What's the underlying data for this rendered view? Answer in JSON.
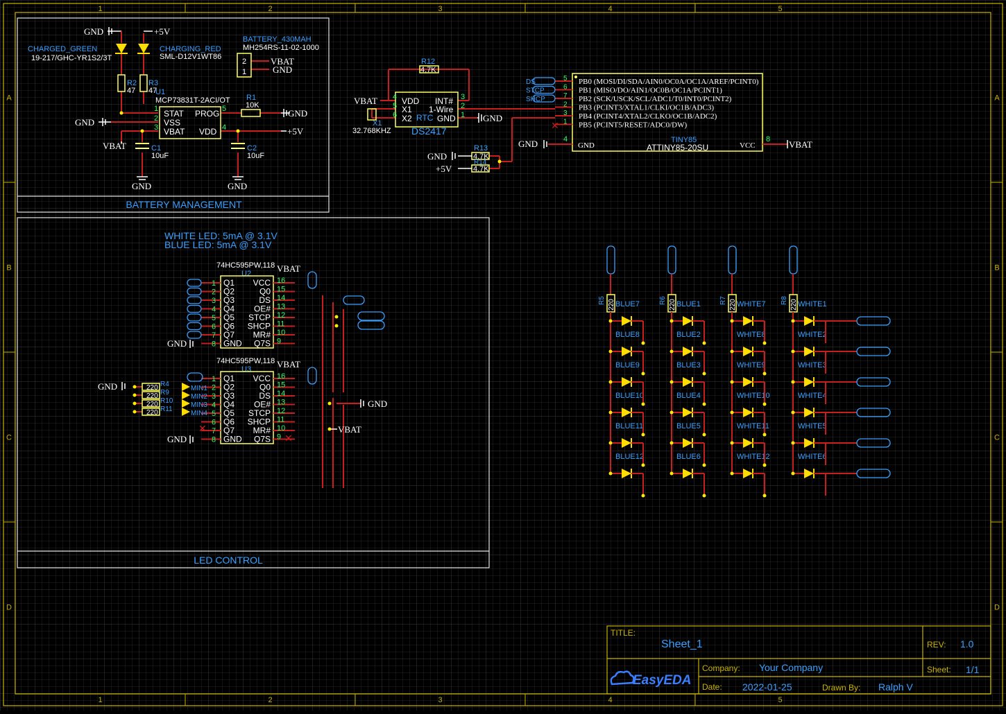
{
  "frame": {
    "columns": [
      "1",
      "2",
      "3",
      "4",
      "5"
    ],
    "rows": [
      "A",
      "B",
      "C",
      "D"
    ]
  },
  "colors": {
    "background": "#000000",
    "grid": "#2a2a2a",
    "frame": "#c8b400",
    "wire": "#c81e1e",
    "body": "#ffff66",
    "pin": "#33ff66",
    "label_blue": "#3aa0ff",
    "net_white": "#ffffff",
    "junction": "#ffee00"
  },
  "battery_management": {
    "title": "BATTERY MANAGEMENT",
    "led_green": {
      "name": "CHARGED_GREEN",
      "part": "19-217/GHC-YR1S2/3T"
    },
    "led_red": {
      "name": "CHARGING_RED",
      "part": "SML-D12V1WT86"
    },
    "battery": {
      "name": "BATTERY_430MAH",
      "part": "MH254RS-11-02-1000",
      "pins": [
        "2",
        "1"
      ]
    },
    "r2": {
      "ref": "R2",
      "value": "47"
    },
    "r3": {
      "ref": "R3",
      "value": "47"
    },
    "u1": {
      "ref": "U1",
      "part": "MCP73831T-2ACI/OT",
      "pins_left": [
        "STAT",
        "VSS",
        "VBAT"
      ],
      "pins_right": [
        "PROG",
        "VDD"
      ],
      "pin_nums_left": [
        "1",
        "2",
        "3"
      ],
      "pin_nums_right": [
        "5",
        "4"
      ]
    },
    "r1": {
      "ref": "R1",
      "value": "10K"
    },
    "c1": {
      "ref": "C1",
      "value": "10uF"
    },
    "c2": {
      "ref": "C2",
      "value": "10uF"
    },
    "nets": {
      "gnd": "GND",
      "vbat": "VBAT",
      "p5v": "+5V"
    }
  },
  "rtc": {
    "ref": "DS2417",
    "pins_left": [
      "VDD",
      "X1",
      "X2"
    ],
    "pins_right": [
      "INT#",
      "1-Wire",
      "GND"
    ],
    "inner": "RTC",
    "pin_nums_left": [
      "4",
      "5",
      "6"
    ],
    "pin_nums_right": [
      "3",
      "2",
      "1"
    ],
    "crystal": {
      "ref": "X1",
      "value": "32.768KHZ"
    },
    "r12": {
      "ref": "R12",
      "value": "4.7K"
    },
    "r13": {
      "ref": "R13",
      "value": "4.7K"
    },
    "r14": {
      "ref": "R14",
      "value": "4.7K"
    }
  },
  "mcu": {
    "name": "TINY85",
    "part": "ATTINY85-20SU",
    "pins": [
      "PB0 (MOSI/DI/SDA/AIN0/OC0A/OC1A/AREF/PCINT0)",
      "PB1 (MISO/DO/AIN1/OC0B/OC1A/PCINT1)",
      "PB2 (SCK/USCK/SCL/ADC1/T0/INT0/PCINT2)",
      "PB3 (PCINT3/XTAL1/CLKI/OC1B/ADC3)",
      "PB4 (PCINT4/XTAL2/CLKO/OC1B/ADC2)",
      "PB5 (PCINT5/RESET/ADC0/DW)"
    ],
    "pin_nums": [
      "5",
      "6",
      "7",
      "2",
      "3",
      "1"
    ],
    "gnd_label": "GND",
    "vcc_label": "VCC",
    "gnd_num": "4",
    "vcc_num": "8",
    "net_flags": [
      "DS",
      "STCP",
      "SHCP"
    ]
  },
  "led_control": {
    "title": "LED CONTROL",
    "note1": "WHITE LED: 5mA @ 3.1V",
    "note2": "BLUE LED: 5mA @ 3.1V",
    "u2": {
      "part": "74HC595PW,118",
      "ref": "U2"
    },
    "u3": {
      "part": "74HC595PW,118",
      "ref": "U3"
    },
    "pins_left": [
      "Q1",
      "Q2",
      "Q3",
      "Q4",
      "Q5",
      "Q6",
      "Q7",
      "GND"
    ],
    "pins_right": [
      "VCC",
      "Q0",
      "DS",
      "OE#",
      "STCP",
      "SHCP",
      "MR#",
      "Q7S"
    ],
    "nums_left": [
      "1",
      "2",
      "3",
      "4",
      "5",
      "6",
      "7",
      "8"
    ],
    "nums_right": [
      "16",
      "15",
      "14",
      "13",
      "12",
      "11",
      "10",
      "9"
    ],
    "u3_leds": [
      "MIN1",
      "MIN2",
      "MIN3",
      "MIN4"
    ],
    "u3_res": [
      "R4",
      "R9",
      "R10",
      "R11"
    ],
    "u3_res_value": "220"
  },
  "matrix": {
    "resistors": [
      {
        "ref": "R5",
        "value": "220"
      },
      {
        "ref": "R6",
        "value": "220"
      },
      {
        "ref": "R7",
        "value": "220"
      },
      {
        "ref": "R8",
        "value": "220"
      }
    ],
    "columns": [
      [
        "BLUE7",
        "BLUE8",
        "BLUE9",
        "BLUE10",
        "BLUE11",
        "BLUE12"
      ],
      [
        "BLUE1",
        "BLUE2",
        "BLUE3",
        "BLUE4",
        "BLUE5",
        "BLUE6"
      ],
      [
        "WHITE7",
        "WHITE8",
        "WHITE9",
        "WHITE10",
        "WHITE11",
        "WHITE12"
      ],
      [
        "WHITE1",
        "WHITE2",
        "WHITE3",
        "WHITE4",
        "WHITE5",
        "WHITE6"
      ]
    ]
  },
  "title_block": {
    "title_label": "TITLE:",
    "title": "Sheet_1",
    "rev_label": "REV:",
    "rev": "1.0",
    "company_label": "Company:",
    "company": "Your Company",
    "sheet_label": "Sheet:",
    "sheet": "1/1",
    "date_label": "Date:",
    "date": "2022-01-25",
    "drawn_label": "Drawn By:",
    "drawn": "Ralph V",
    "logo_text": "EasyEDA"
  }
}
